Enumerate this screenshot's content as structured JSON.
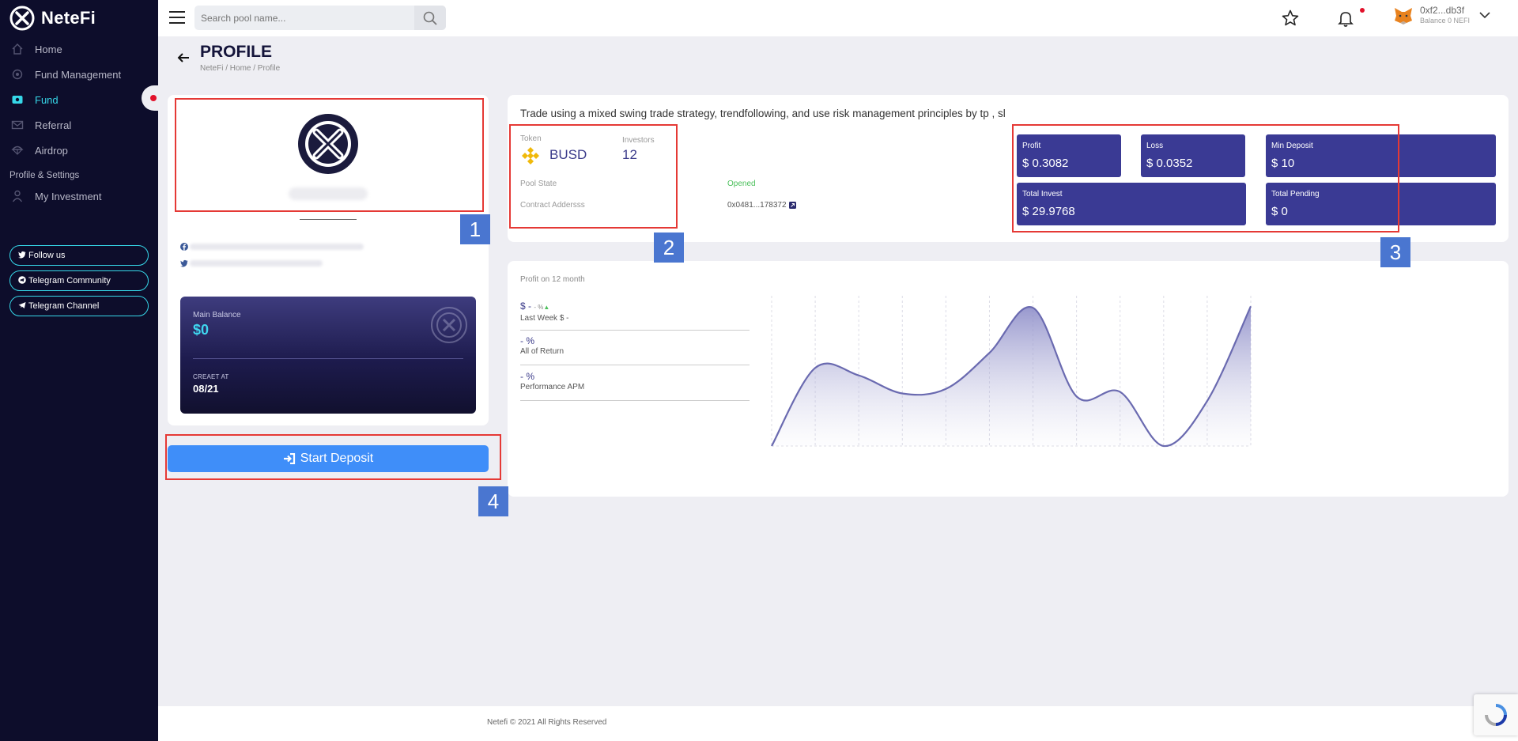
{
  "app": {
    "logo_text": "NeteFi"
  },
  "sidebar": {
    "items": [
      {
        "label": "Home",
        "icon": "home-icon"
      },
      {
        "label": "Fund Management",
        "icon": "gear-icon"
      },
      {
        "label": "Fund",
        "icon": "wallet-icon",
        "active": true
      },
      {
        "label": "Referral",
        "icon": "envelope-icon"
      },
      {
        "label": "Airdrop",
        "icon": "parachute-icon"
      }
    ],
    "section_label": "Profile & Settings",
    "section_items": [
      {
        "label": "My Investment",
        "icon": "person-icon"
      }
    ],
    "social": [
      {
        "label": "Follow us",
        "icon": "twitter-icon"
      },
      {
        "label": "Telegram Community",
        "icon": "telegram-icon"
      },
      {
        "label": "Telegram Channel",
        "icon": "send-icon"
      }
    ]
  },
  "topbar": {
    "search_placeholder": "Search pool name...",
    "wallet_address": "0xf2...db3f",
    "wallet_balance": "Balance 0 NEFI"
  },
  "page": {
    "title": "PROFILE",
    "breadcrumb": "NeteFi / Home / Profile"
  },
  "profile": {
    "main_balance_label": "Main Balance",
    "main_balance_value": "$0",
    "created_label": "CREAET AT",
    "created_value": "08/21",
    "deposit_button": "Start Deposit"
  },
  "pool": {
    "strategy": "Trade using a mixed swing trade strategy, trendfollowing, and use risk management principles by tp , sl",
    "token_label": "Token",
    "token_value": "BUSD",
    "investors_label": "Investors",
    "investors_value": "12",
    "pool_state_label": "Pool State",
    "pool_state_value": "Opened",
    "contract_label": "Contract Addersss",
    "contract_value": "0x0481...178372"
  },
  "stats": {
    "profit_label": "Profit",
    "profit_value": "$ 0.3082",
    "loss_label": "Loss",
    "loss_value": "$ 0.0352",
    "min_deposit_label": "Min Deposit",
    "min_deposit_value": "$ 10",
    "total_invest_label": "Total Invest",
    "total_invest_value": "$ 29.9768",
    "total_pending_label": "Total Pending",
    "total_pending_value": "$ 0"
  },
  "metrics": {
    "title": "Profit on 12 month",
    "m1_top": "$ - ",
    "m1_pct": "- %",
    "m1_sub": "Last Week $ -",
    "m2_top": "- %",
    "m2_sub": "All of Return",
    "m3_top": "- %",
    "m3_sub": "Performance APM"
  },
  "chart_data": {
    "type": "area",
    "title": "Profit on 12 month",
    "x": [
      1,
      2,
      3,
      4,
      5,
      6,
      7,
      8,
      9,
      10,
      11,
      12
    ],
    "values": [
      0,
      52,
      47,
      35,
      38,
      62,
      92,
      33,
      36,
      0,
      30,
      93
    ],
    "ylim": [
      0,
      100
    ],
    "grid": "vertical dashed",
    "color": "#6a6ab0"
  },
  "footer": {
    "text": "Netefi © 2021 All Rights Reserved"
  },
  "annotations": [
    "1",
    "2",
    "3",
    "4"
  ],
  "colors": {
    "sidebar_bg": "#0d0d2b",
    "accent_cyan": "#36d7e8",
    "stat_bg": "#3a3a94",
    "button_blue": "#3f8ef9",
    "annotation_red": "#e53935",
    "annotation_blue": "#4a76d0"
  }
}
